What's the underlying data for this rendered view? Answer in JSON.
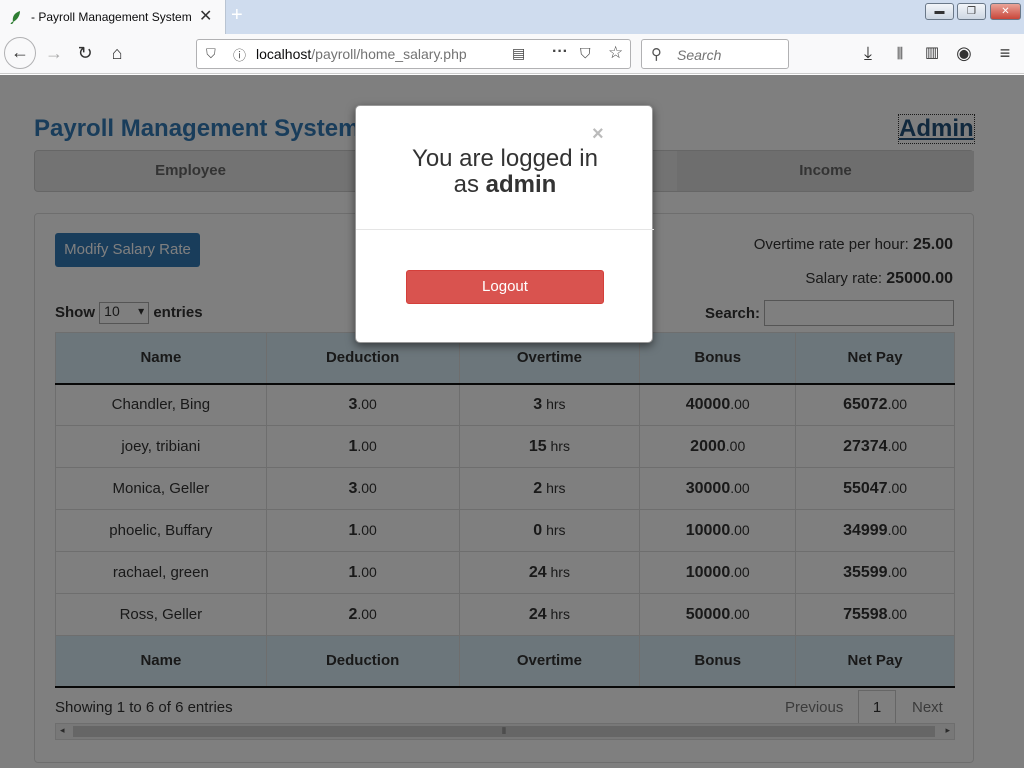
{
  "browser": {
    "tab_title": "- Payroll Management System",
    "tab_close": "✕",
    "new_tab": "+",
    "url_host": "localhost",
    "url_path": "/payroll/home_salary.php",
    "search_placeholder": "Search"
  },
  "app": {
    "title": "Payroll Management System",
    "admin_link": "Admin",
    "menu": [
      "Employee",
      "",
      "",
      "Income"
    ],
    "modify_button": "Modify Salary Rate",
    "overtime_label": "Overtime rate per hour:",
    "overtime_value": "25.00",
    "salary_label": "Salary rate:",
    "salary_value": "25000.00",
    "show_label": "Show",
    "entries_select": "10",
    "entries_label": "entries",
    "search_label": "Search:",
    "columns": [
      "Name",
      "Deduction",
      "Overtime",
      "Bonus",
      "Net Pay"
    ],
    "rows": [
      {
        "name": "Chandler, Bing",
        "deduction": "3",
        "overtime": "3",
        "bonus": "40000",
        "net": "65072"
      },
      {
        "name": "joey, tribiani",
        "deduction": "1",
        "overtime": "15",
        "bonus": "2000",
        "net": "27374"
      },
      {
        "name": "Monica, Geller",
        "deduction": "3",
        "overtime": "2",
        "bonus": "30000",
        "net": "55047"
      },
      {
        "name": "phoelic, Buffary",
        "deduction": "1",
        "overtime": "0",
        "bonus": "10000",
        "net": "34999"
      },
      {
        "name": "rachael, green",
        "deduction": "1",
        "overtime": "24",
        "bonus": "10000",
        "net": "35599"
      },
      {
        "name": "Ross, Geller",
        "deduction": "2",
        "overtime": "24",
        "bonus": "50000",
        "net": "75598"
      }
    ],
    "decimal_suffix": ".00",
    "hours_suffix": " hrs",
    "info": "Showing 1 to 6 of 6 entries",
    "prev": "Previous",
    "page": "1",
    "next": "Next"
  },
  "modal": {
    "close": "×",
    "line1": "You are logged in",
    "line2_prefix": "as ",
    "line2_user": "admin",
    "logout": "Logout"
  }
}
